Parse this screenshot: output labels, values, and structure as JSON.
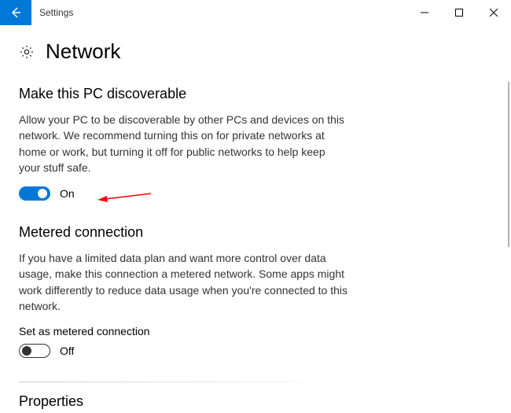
{
  "window": {
    "title": "Settings"
  },
  "page": {
    "title": "Network"
  },
  "sections": {
    "discoverable": {
      "title": "Make this PC discoverable",
      "desc": "Allow your PC to be discoverable by other PCs and devices on this network. We recommend turning this on for private networks at home or work, but turning it off for public networks to help keep your stuff safe.",
      "toggle_state": "On"
    },
    "metered": {
      "title": "Metered connection",
      "desc": "If you have a limited data plan and want more control over data usage, make this connection a metered network. Some apps might work differently to reduce data usage when you're connected to this network.",
      "label": "Set as metered connection",
      "toggle_state": "Off"
    },
    "properties": {
      "title": "Properties"
    }
  }
}
